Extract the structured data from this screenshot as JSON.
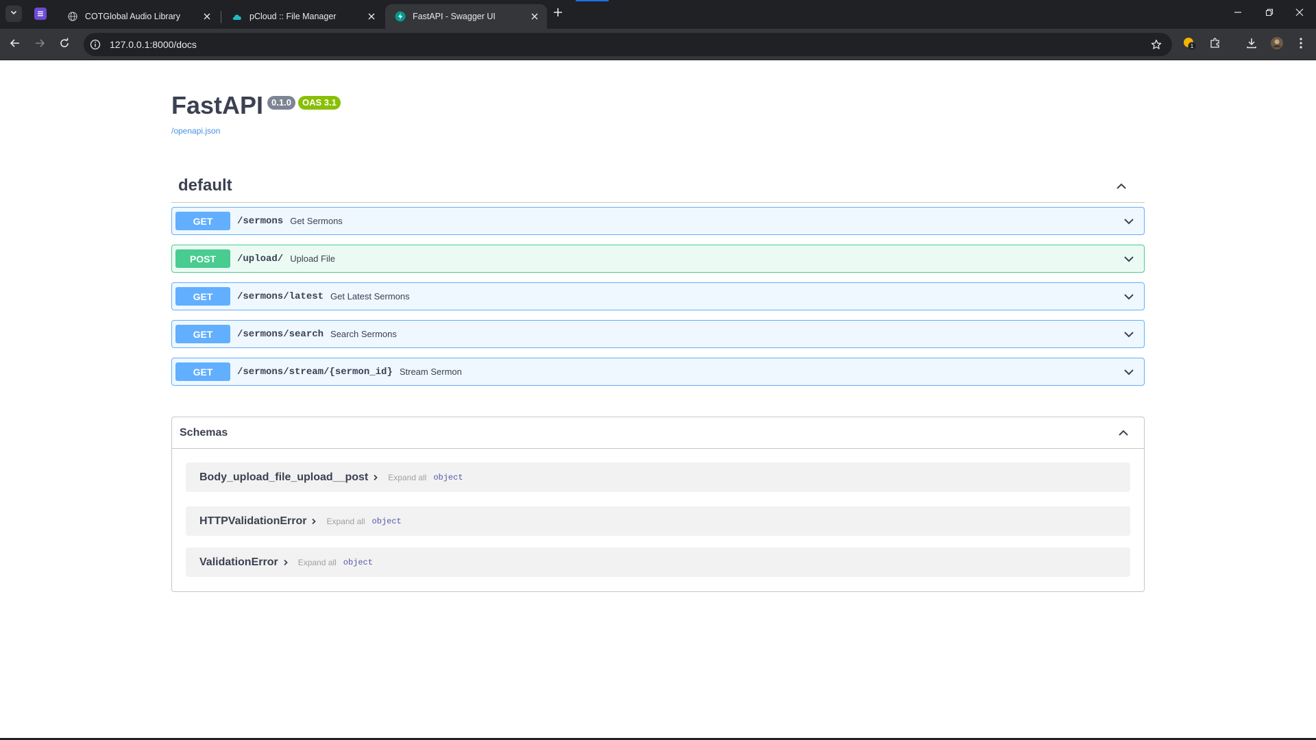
{
  "browser": {
    "tabs": [
      {
        "title": "COTGlobal Audio Library",
        "icon": "globe-icon",
        "active": false
      },
      {
        "title": "pCloud :: File Manager",
        "icon": "pcloud-icon",
        "active": false
      },
      {
        "title": "FastAPI - Swagger UI",
        "icon": "fastapi-icon",
        "active": true
      }
    ],
    "url": "127.0.0.1:8000/docs",
    "extension_badge": "1"
  },
  "info": {
    "title": "FastAPI",
    "version": "0.1.0",
    "oas": "OAS 3.1",
    "spec_link": "/openapi.json"
  },
  "tag": {
    "name": "default"
  },
  "operations": [
    {
      "method": "GET",
      "path": "/sermons",
      "summary": "Get Sermons"
    },
    {
      "method": "POST",
      "path": "/upload/",
      "summary": "Upload File"
    },
    {
      "method": "GET",
      "path": "/sermons/latest",
      "summary": "Get Latest Sermons"
    },
    {
      "method": "GET",
      "path": "/sermons/search",
      "summary": "Search Sermons"
    },
    {
      "method": "GET",
      "path": "/sermons/stream/{sermon_id}",
      "summary": "Stream Sermon"
    }
  ],
  "schemas": {
    "title": "Schemas",
    "expand_label": "Expand all",
    "items": [
      {
        "name": "Body_upload_file_upload__post",
        "type": "object"
      },
      {
        "name": "HTTPValidationError",
        "type": "object"
      },
      {
        "name": "ValidationError",
        "type": "object"
      }
    ]
  },
  "colors": {
    "get": "#61affe",
    "post": "#49cc90",
    "version_badge": "#7d8492",
    "oas_badge": "#89bf04",
    "link": "#4990e2"
  }
}
